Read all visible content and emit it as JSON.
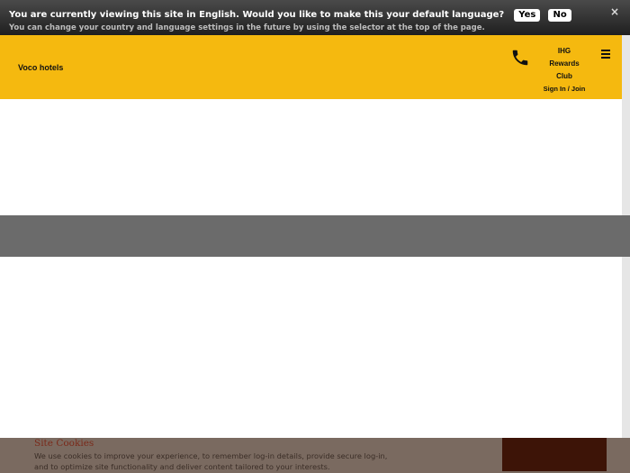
{
  "language_banner": {
    "question": "You are currently viewing this site in English. Would you like to make this your default language?",
    "yes_label": "Yes",
    "no_label": "No",
    "note": "You can change your country and language settings in the future by using the selector at the top of the page.",
    "close_glyph": "×"
  },
  "header": {
    "brand": "Voco hotels",
    "rewards_line1": "IHG",
    "rewards_line2": "Rewards",
    "rewards_line3": "Club",
    "signin_label": "Sign In / Join",
    "accent_color": "#f5b90f"
  },
  "cookie_notice": {
    "title": "Site Cookies",
    "text": "We use cookies to improve your experience, to remember log-in details, provide secure log-in, and to optimize site functionality and deliver content tailored to your interests."
  }
}
